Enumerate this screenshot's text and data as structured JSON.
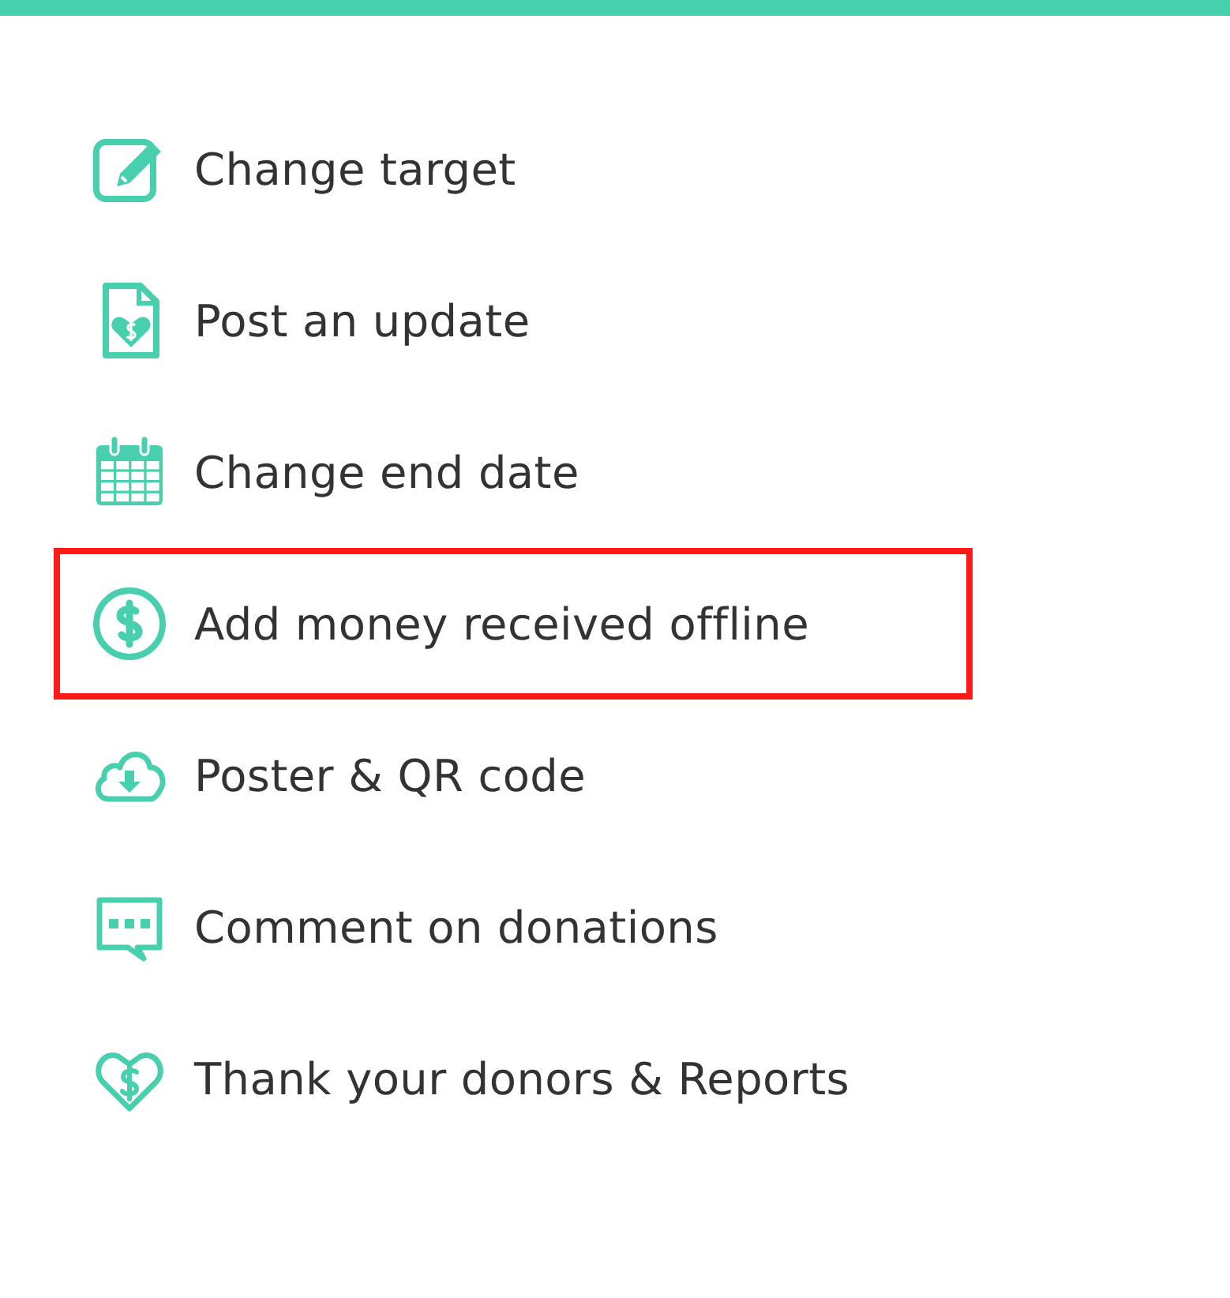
{
  "menu": [
    {
      "kind": "edit",
      "label": "Change target",
      "highlighted": false
    },
    {
      "kind": "document",
      "label": "Post an update",
      "highlighted": false
    },
    {
      "kind": "calendar",
      "label": "Change end date",
      "highlighted": false
    },
    {
      "kind": "dollar",
      "label": "Add money received offline",
      "highlighted": true
    },
    {
      "kind": "cloud",
      "label": "Poster & QR code",
      "highlighted": false
    },
    {
      "kind": "comment",
      "label": "Comment on donations",
      "highlighted": false
    },
    {
      "kind": "heart",
      "label": "Thank your donors & Reports",
      "highlighted": false
    }
  ]
}
